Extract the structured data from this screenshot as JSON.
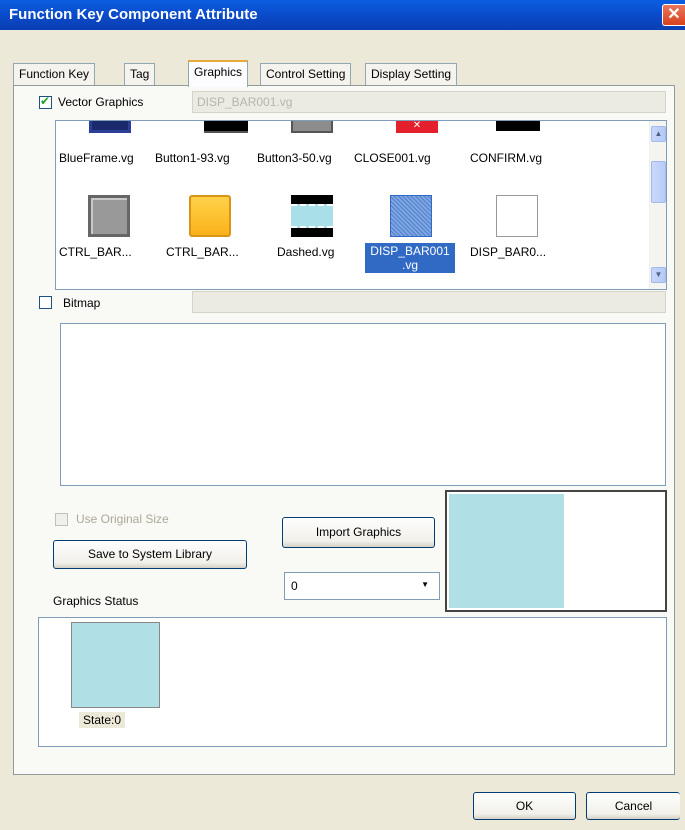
{
  "window": {
    "title": "Function Key Component Attribute",
    "close_glyph": "✕"
  },
  "tabs": [
    {
      "label": "Function Key"
    },
    {
      "label": "Tag"
    },
    {
      "label": "Graphics"
    },
    {
      "label": "Control Setting"
    },
    {
      "label": "Display Setting"
    }
  ],
  "active_tab": "Graphics",
  "vector_graphics": {
    "label": "Vector Graphics",
    "checked": true,
    "selected_file": "DISP_BAR001.vg",
    "files_row1": [
      "BlueFrame.vg",
      "Button1-93.vg",
      "Button3-50.vg",
      "CLOSE001.vg",
      "CONFIRM.vg"
    ],
    "files_row2": [
      "CTRL_BAR...",
      "CTRL_BAR...",
      "Dashed.vg",
      "DISP_BAR001",
      "DISP_BAR0..."
    ],
    "selected_label_line2": ".vg"
  },
  "bitmap": {
    "label": "Bitmap",
    "checked": false,
    "path": ""
  },
  "use_original_size": {
    "label": "Use Original Size",
    "checked": false,
    "enabled": false
  },
  "buttons": {
    "save_to_library": "Save to System Library",
    "import_graphics": "Import Graphics",
    "ok": "OK",
    "cancel": "Cancel"
  },
  "state_combo": {
    "value": "0"
  },
  "graphics_status": {
    "label": "Graphics Status",
    "states": [
      {
        "label": "State:0",
        "color": "#b0dfe5"
      }
    ]
  },
  "colors": {
    "accent": "#316ac5",
    "state_fill": "#b0dfe5",
    "titlebar": "#0a4fd0"
  }
}
